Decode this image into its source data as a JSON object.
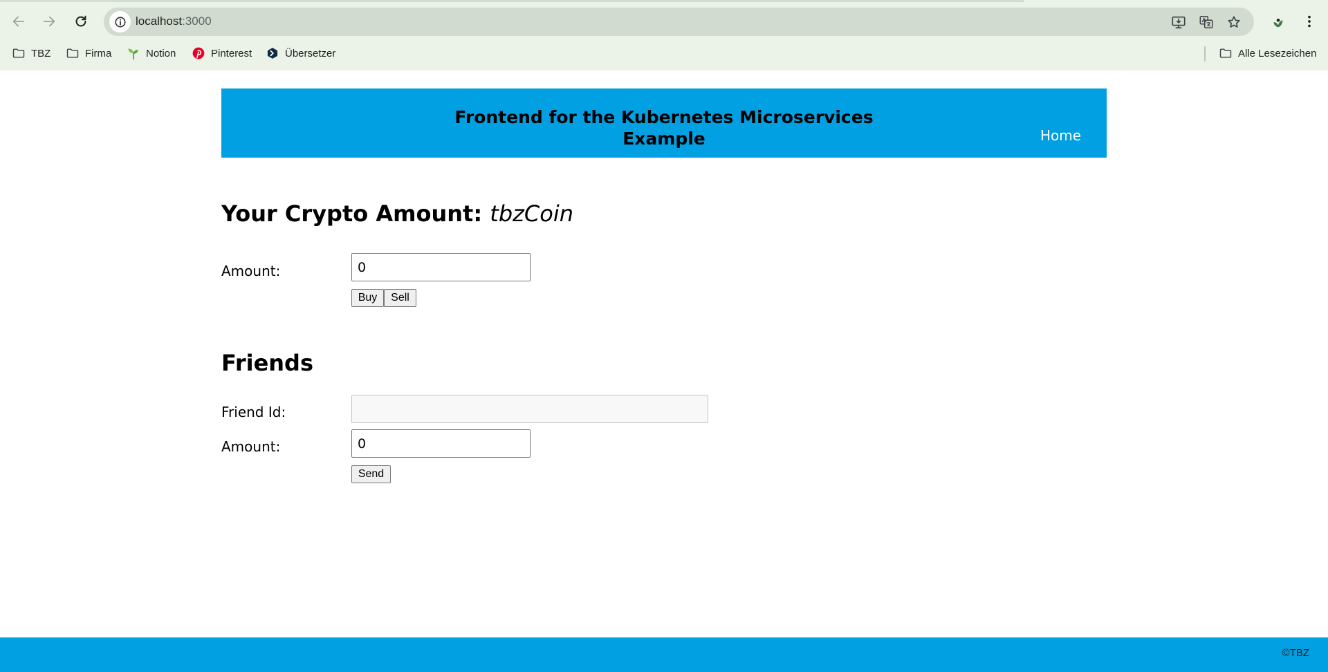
{
  "browser": {
    "url_host": "localhost",
    "url_port": ":3000",
    "bookmarks": [
      {
        "label": "TBZ",
        "icon": "folder-icon"
      },
      {
        "label": "Firma",
        "icon": "folder-icon"
      },
      {
        "label": "Notion",
        "icon": "sprout-icon"
      },
      {
        "label": "Pinterest",
        "icon": "pinterest-icon"
      },
      {
        "label": "Übersetzer",
        "icon": "translator-icon"
      }
    ],
    "all_bookmarks_label": "Alle Lesezeichen"
  },
  "header": {
    "title": "Frontend for the Kubernetes Microservices Example",
    "home_link": "Home"
  },
  "crypto": {
    "title_prefix": "Your Crypto Amount:",
    "coin_name": "tbzCoin",
    "amount_label": "Amount:",
    "amount_value": "0",
    "buy_label": "Buy",
    "sell_label": "Sell"
  },
  "friends": {
    "title": "Friends",
    "friend_id_label": "Friend Id:",
    "friend_id_value": "",
    "amount_label": "Amount:",
    "amount_value": "0",
    "send_label": "Send"
  },
  "footer": {
    "text": "©TBZ"
  },
  "colors": {
    "accent": "#00a0e2",
    "chrome_bg": "#ebf2e8"
  }
}
